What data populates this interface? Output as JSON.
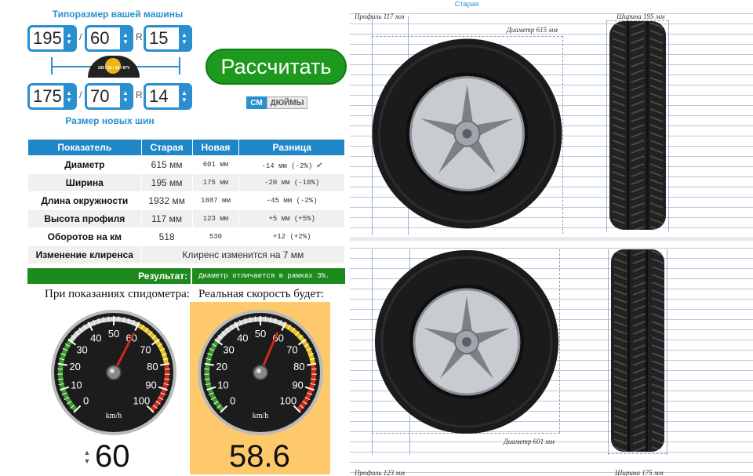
{
  "form": {
    "current_title": "Типоразмер вашей машины",
    "new_title": "Размер новых шин",
    "current": {
      "width": "195",
      "profile": "60",
      "radius_letter": "R",
      "diameter": "15"
    },
    "new": {
      "width": "175",
      "profile": "70",
      "radius_letter": "R",
      "diameter": "14"
    },
    "slash": "/",
    "logo_text": "195 / 65 / 16 / 87V",
    "calculate_label": "Рассчитать",
    "unit_cm": "СМ",
    "unit_inch": "ДЮЙМЫ"
  },
  "table": {
    "headers": [
      "Показатель",
      "Старая",
      "Новая",
      "Разница"
    ],
    "rows": [
      {
        "label": "Диаметр",
        "old": "615 мм",
        "new": "601 мм",
        "diff": "-14 мм (-2%)",
        "check": "✔"
      },
      {
        "label": "Ширина",
        "old": "195 мм",
        "new": "175 мм",
        "diff": "-20 мм (-10%)"
      },
      {
        "label": "Длина окружности",
        "old": "1932 мм",
        "new": "1887 мм",
        "diff": "-45 мм (-2%)"
      },
      {
        "label": "Высота профиля",
        "old": "117 мм",
        "new": "123 мм",
        "diff": "+5 мм (+5%)"
      },
      {
        "label": "Оборотов на км",
        "old": "518",
        "new": "530",
        "diff": "+12 (+2%)"
      }
    ],
    "clearance_label": "Изменение клиренса",
    "clearance_text": "Клиренс изменится на 7 мм",
    "result_label": "Результат:",
    "result_text": "Диаметр отличается в рамках 3%."
  },
  "speed": {
    "left_title": "При показаниях спидометра:",
    "right_title": "Реальная скорость будет:",
    "speedometer_value": "60",
    "real_value": "58.6",
    "speedometer_needle": 60,
    "real_needle": 58.6,
    "ticks": [
      "0",
      "10",
      "20",
      "30",
      "40",
      "50",
      "60",
      "70",
      "80",
      "90",
      "100"
    ],
    "unit": "km/h",
    "stepper_up": "▲",
    "stepper_down": "▼"
  },
  "drawing": {
    "title": "Старая",
    "old_profile": "Профиль 117 мм",
    "old_diameter": "Диаметр 615 мм",
    "old_width": "Ширина 195 мм",
    "new_profile": "Профиль 123 мм",
    "new_diameter": "Диаметр 601 мм",
    "new_width": "Ширина 175 мм"
  },
  "colors": {
    "accent": "#2a8fcf",
    "button_green": "#1d9a1d",
    "result_green": "#1d8a1d",
    "highlight": "#fdc96a"
  }
}
